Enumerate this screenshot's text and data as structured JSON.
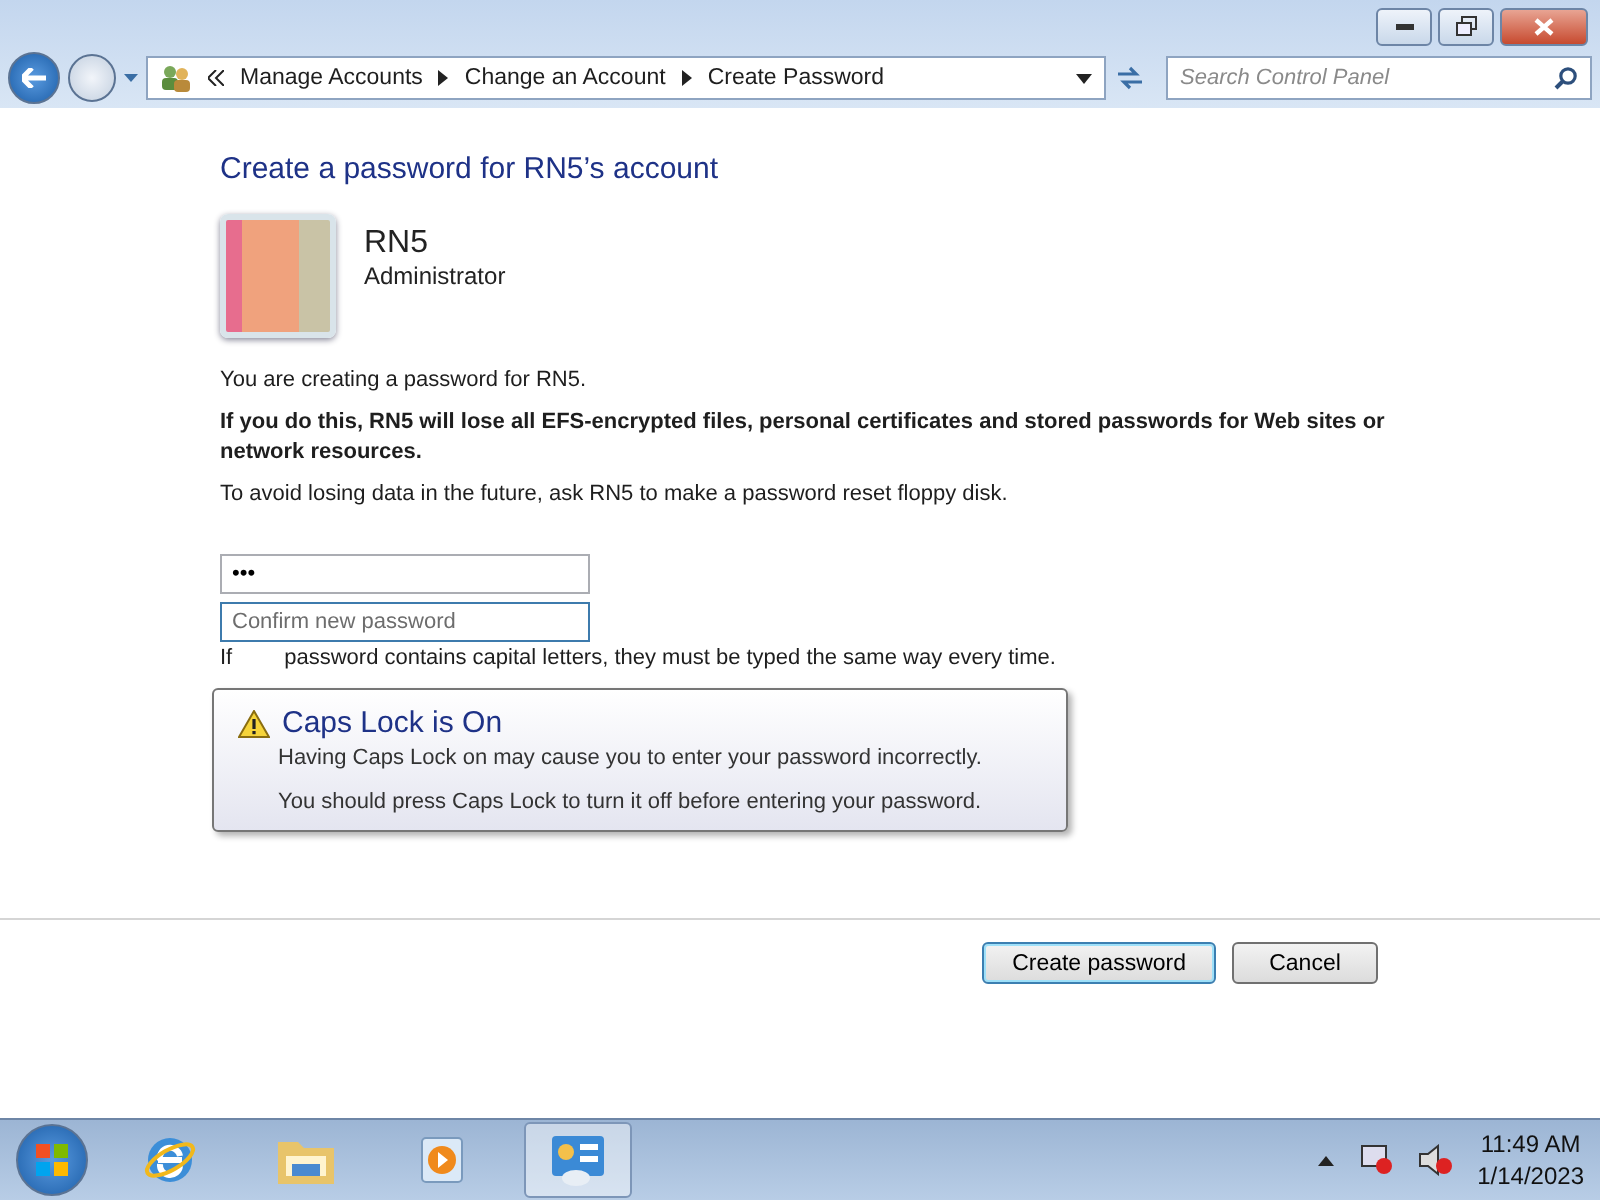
{
  "address_bar": {
    "breadcrumbs": [
      "Manage Accounts",
      "Change an Account",
      "Create Password"
    ]
  },
  "search": {
    "placeholder": "Search Control Panel"
  },
  "heading": "Create a password for RN5’s account",
  "account": {
    "name": "RN5",
    "role": "Administrator"
  },
  "paragraphs": [
    {
      "text": "You are creating a password for RN5.",
      "bold": false
    },
    {
      "text": "If you do this, RN5 will lose all EFS-encrypted files, personal certificates and stored passwords for Web sites or network resources.",
      "bold": true
    },
    {
      "text": "To avoid losing data in the future, ask RN5 to make a password reset floppy disk.",
      "bold": false
    }
  ],
  "fields": [
    {
      "value": "•••",
      "focused": false
    },
    {
      "placeholder": "Confirm new password",
      "focused": true
    }
  ],
  "hint": {
    "lead": "If",
    "rest": "password contains capital letters, they must be typed the same way every time."
  },
  "tooltip": {
    "title": "Caps Lock is On",
    "lines": [
      "Having Caps Lock on may cause you to enter your password incorrectly.",
      "You should press Caps Lock to turn it off before entering your password."
    ]
  },
  "buttons": [
    {
      "label": "Create password",
      "default": true
    },
    {
      "label": "Cancel",
      "default": false
    }
  ],
  "taskbar": {
    "apps": [
      {
        "kind": "browser",
        "selected": false
      },
      {
        "kind": "folder",
        "selected": false
      },
      {
        "kind": "media",
        "selected": false
      },
      {
        "kind": "control",
        "selected": true
      }
    ],
    "time": "11:49 AM",
    "date": "1/14/2023"
  }
}
